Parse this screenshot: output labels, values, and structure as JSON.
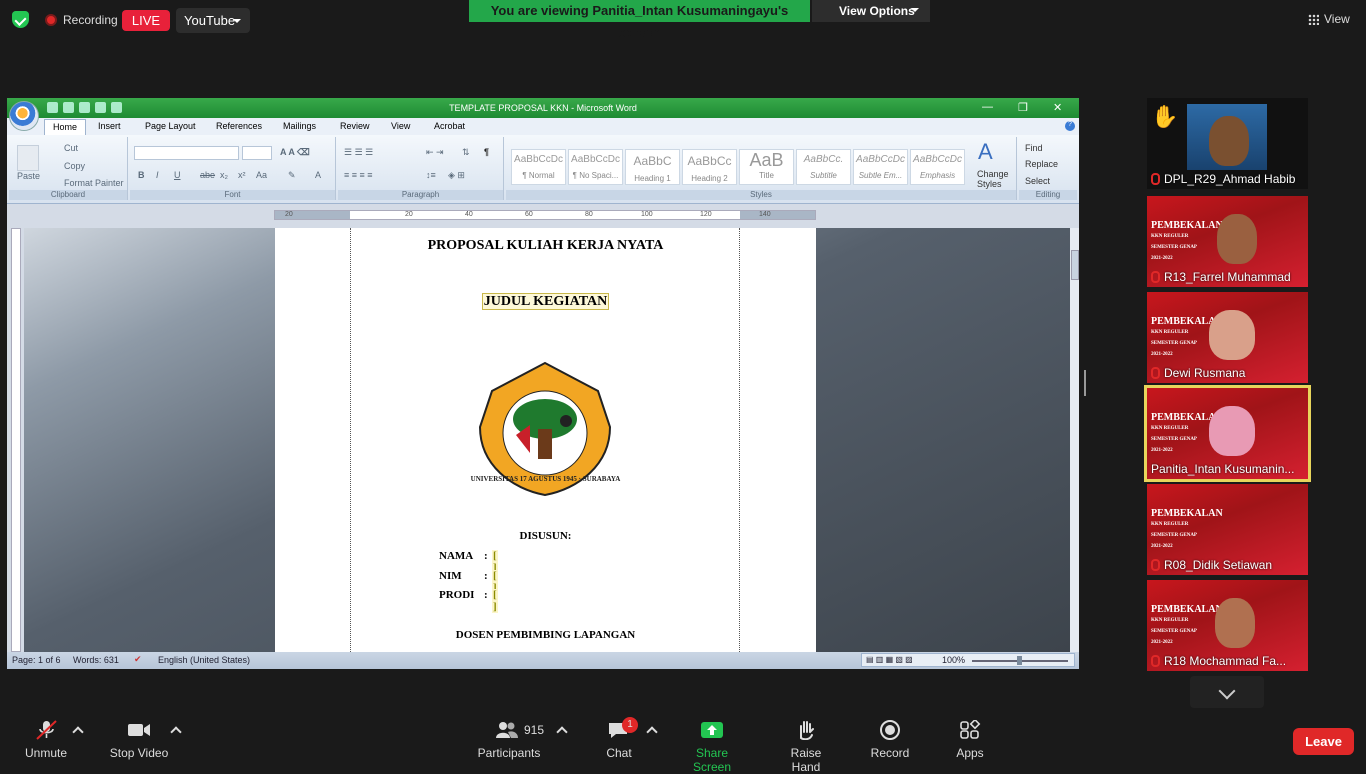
{
  "topbar": {
    "recording": "Recording",
    "live": "LIVE",
    "stream": "YouTube",
    "viewing": "You are viewing Panitia_Intan Kusumaningayu's screen",
    "view_options": "View Options",
    "view": "View"
  },
  "word": {
    "title": "TEMPLATE PROPOSAL KKN - Microsoft Word",
    "tabs": [
      "Home",
      "Insert",
      "Page Layout",
      "References",
      "Mailings",
      "Review",
      "View",
      "Acrobat"
    ],
    "clipboard": {
      "paste": "Paste",
      "cut": "Cut",
      "copy": "Copy",
      "painter": "Format Painter",
      "label": "Clipboard"
    },
    "font_label": "Font",
    "paragraph_label": "Paragraph",
    "styles_label": "Styles",
    "editing_label": "Editing",
    "styles": [
      {
        "sample": "AaBbCcDc",
        "name": "¶ Normal"
      },
      {
        "sample": "AaBbCcDc",
        "name": "¶ No Spaci..."
      },
      {
        "sample": "AaBbC",
        "name": "Heading 1"
      },
      {
        "sample": "AaBbCc",
        "name": "Heading 2"
      },
      {
        "sample": "AaB",
        "name": "Title"
      },
      {
        "sample": "AaBbCc.",
        "name": "Subtitle"
      },
      {
        "sample": "AaBbCcDc",
        "name": "Subtle Em..."
      },
      {
        "sample": "AaBbCcDc",
        "name": "Emphasis"
      }
    ],
    "change_styles": "Change Styles",
    "find": "Find",
    "replace": "Replace",
    "select": "Select",
    "ruler": [
      "20",
      "",
      "20",
      "40",
      "60",
      "80",
      "100",
      "120",
      "140"
    ],
    "doc": {
      "heading": "PROPOSAL KULIAH KERJA NYATA",
      "subtitle": "JUDUL KEGIATAN",
      "logo_text": "UNIVERSITAS 17 AGUSTUS 1945",
      "logo_city": "SURABAYA",
      "disusun": "DISUSUN:",
      "nama": "NAMA",
      "nim": "NIM",
      "prodi": "PRODI",
      "colon": ":",
      "blank": "[ ]",
      "dosen": "DOSEN PEMBIMBING LAPANGAN"
    },
    "status": {
      "page": "Page: 1 of 6",
      "words": "Words: 631",
      "lang": "English (United States)",
      "zoom": "100%"
    }
  },
  "participants": [
    {
      "name": "DPL_R29_Ahmad Habib",
      "raised": true
    },
    {
      "name": "R13_Farrel Muhammad"
    },
    {
      "name": "Dewi Rusmana"
    },
    {
      "name": "Panitia_Intan Kusumanin...",
      "active": true
    },
    {
      "name": "R08_Didik Setiawan"
    },
    {
      "name": "R18 Mochammad Fa..."
    }
  ],
  "banner": {
    "line1": "PEMBEKALAN",
    "line2": "KKN REGULER",
    "line3": "SEMESTER GENAP",
    "line4": "2021-2022"
  },
  "toolbar": {
    "unmute": "Unmute",
    "stop_video": "Stop Video",
    "participants": "Participants",
    "participants_count": "915",
    "chat": "Chat",
    "chat_badge": "1",
    "share": "Share Screen",
    "raise": "Raise Hand",
    "record": "Record",
    "apps": "Apps",
    "leave": "Leave"
  }
}
